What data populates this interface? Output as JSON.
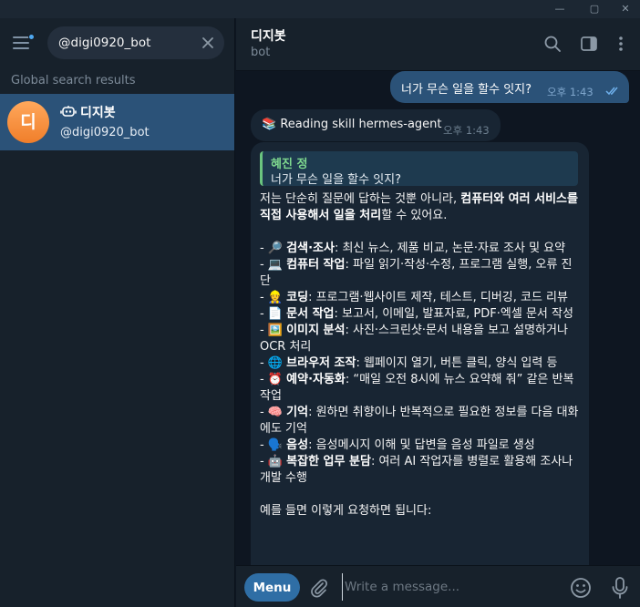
{
  "window": {
    "minimize_glyph": "—",
    "maximize_glyph": "▢",
    "close_glyph": "✕"
  },
  "sidebar": {
    "search_value": "@digi0920_bot",
    "section_label": "Global search results",
    "result": {
      "avatar_letter": "디",
      "name": "디지봇",
      "username": "@digi0920_bot",
      "icon": "bot-icon"
    }
  },
  "header": {
    "title": "디지봇",
    "status": "bot",
    "icons": [
      "search-icon",
      "sidebar-toggle-icon",
      "more-vertical-icon"
    ]
  },
  "messages": {
    "outgoing": {
      "text": "너가 무슨 일을 할수 잇지?",
      "time": "오후 1:43",
      "read": true
    },
    "status": {
      "text": "📚 Reading skill hermes-agent",
      "time": "오후 1:43"
    },
    "reply": {
      "quote_author": "혜진 정",
      "quote_text": "너가 무슨 일을 할수 잇지?",
      "intro_pre": "저는 단순히 질문에 답하는 것뿐 아니라, ",
      "intro_bold": "컴퓨터와 여러 서비스를 직접 사용해서 일을 처리",
      "intro_post": "할 수 있어요.",
      "items": [
        {
          "prefix": "- 🔎 ",
          "bold": "검색·조사",
          "text": ": 최신 뉴스, 제품 비교, 논문·자료 조사 및 요약"
        },
        {
          "prefix": "- 💻 ",
          "bold": "컴퓨터 작업",
          "text": ": 파일 읽기·작성·수정, 프로그램 실행, 오류 진단"
        },
        {
          "prefix": "- 👷 ",
          "bold": "코딩",
          "text": ": 프로그램·웹사이트 제작, 테스트, 디버깅, 코드 리뷰"
        },
        {
          "prefix": "- 📄 ",
          "bold": "문서 작업",
          "text": ": 보고서, 이메일, 발표자료, PDF·엑셀 문서 작성"
        },
        {
          "prefix": "- 🖼️ ",
          "bold": "이미지 분석",
          "text": ": 사진·스크린샷·문서 내용을 보고 설명하거나 OCR 처리"
        },
        {
          "prefix": "- 🌐 ",
          "bold": "브라우저 조작",
          "text": ": 웹페이지 열기, 버튼 클릭, 양식 입력 등"
        },
        {
          "prefix": "- ⏰ ",
          "bold": "예약·자동화",
          "text": ": “매일 오전 8시에 뉴스 요약해 줘” 같은 반복 작업"
        },
        {
          "prefix": "- 🧠 ",
          "bold": "기억",
          "text": ": 원하면 취향이나 반복적으로 필요한 정보를 다음 대화에도 기억"
        },
        {
          "prefix": "- 🗣️ ",
          "bold": "음성",
          "text": ": 음성메시지 이해 및 답변을 음성 파일로 생성"
        },
        {
          "prefix": "- 🤖 ",
          "bold": "복잡한 업무 분담",
          "text": ": 여러 AI 작업자를 병렬로 활용해 조사나 개발 수행"
        }
      ],
      "outro": "예를 들면 이렇게 요청하면 됩니다:"
    }
  },
  "composer": {
    "menu_label": "Menu",
    "placeholder": "Write a message..."
  },
  "colors": {
    "accent": "#2f6ea5",
    "selected_row": "#2b5278",
    "outgoing_bubble": "#2b5278",
    "incoming_bubble": "#182533",
    "quote_author": "#7fd98f"
  }
}
